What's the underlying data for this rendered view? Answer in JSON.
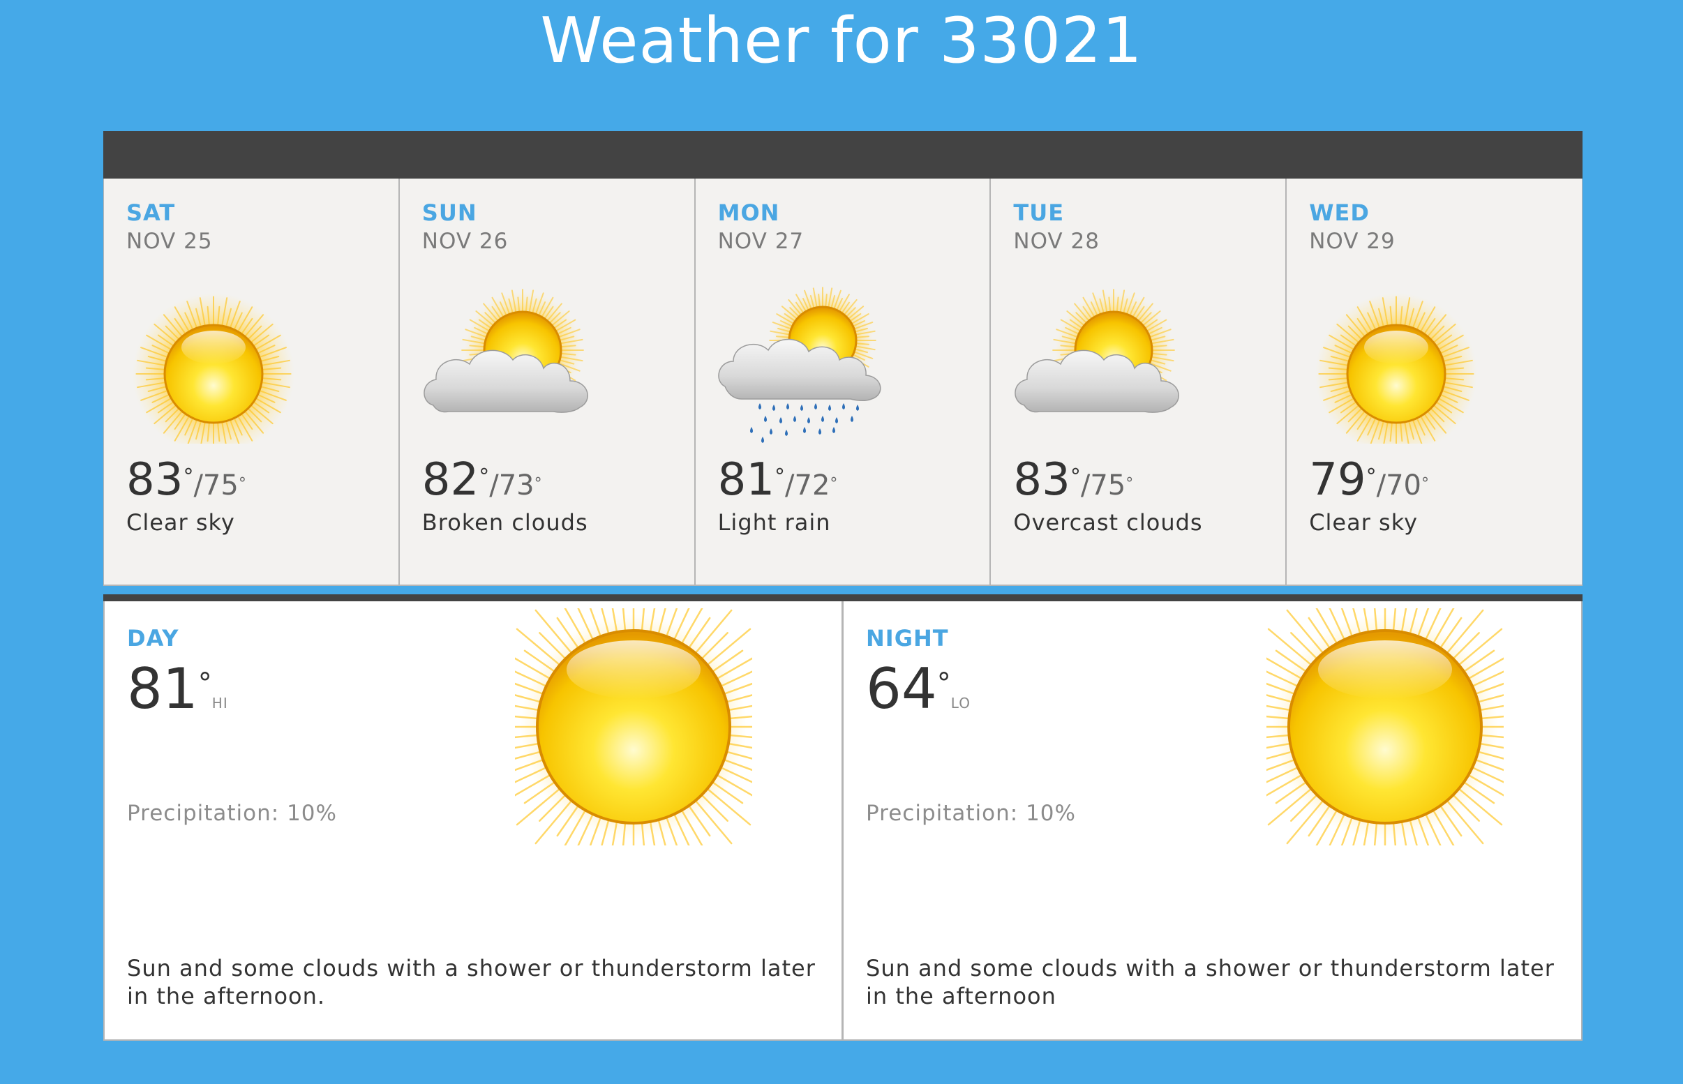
{
  "title": "Weather for 33021",
  "forecast": [
    {
      "dow": "SAT",
      "date": "NOV 25",
      "icon": "clear-sky-icon",
      "hi": "83",
      "lo": "75",
      "condition": "Clear sky"
    },
    {
      "dow": "SUN",
      "date": "NOV 26",
      "icon": "broken-clouds-icon",
      "hi": "82",
      "lo": "73",
      "condition": "Broken clouds"
    },
    {
      "dow": "MON",
      "date": "NOV 27",
      "icon": "light-rain-icon",
      "hi": "81",
      "lo": "72",
      "condition": "Light rain"
    },
    {
      "dow": "TUE",
      "date": "NOV 28",
      "icon": "overcast-clouds-icon",
      "hi": "83",
      "lo": "75",
      "condition": "Overcast clouds"
    },
    {
      "dow": "WED",
      "date": "NOV 29",
      "icon": "clear-sky-icon",
      "hi": "79",
      "lo": "70",
      "condition": "Clear sky"
    }
  ],
  "day": {
    "label": "DAY",
    "temp": "81",
    "tag": "HI",
    "precip": "Precipitation: 10%",
    "summary": "Sun and some clouds with a shower or thunderstorm later in the afternoon.",
    "icon": "sun-icon"
  },
  "night": {
    "label": "NIGHT",
    "temp": "64",
    "tag": "LO",
    "precip": "Precipitation: 10%",
    "summary": "Sun and some clouds with a shower or thunderstorm later in the afternoon",
    "icon": "sun-icon"
  },
  "units": {
    "degree": "°",
    "slash": "/"
  },
  "colors": {
    "background": "#45a9e8",
    "accent": "#4aa6e2",
    "bar": "#434343",
    "card": "#f3f2f0"
  }
}
